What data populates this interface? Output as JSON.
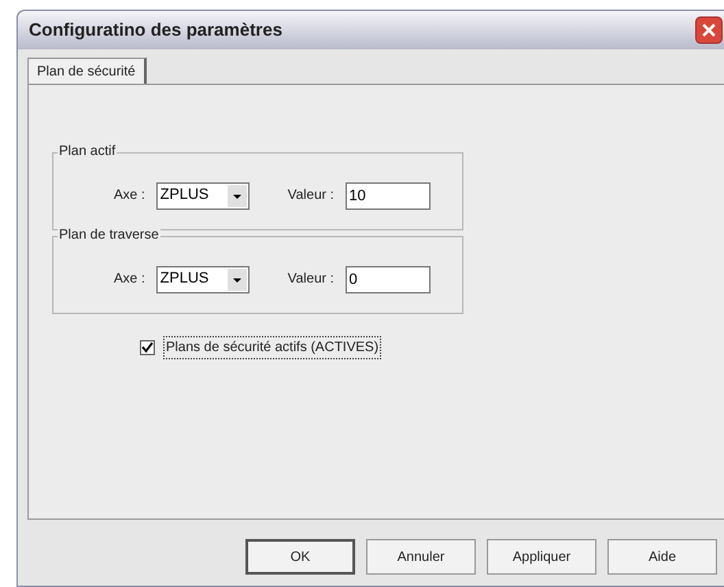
{
  "window": {
    "title": "Configuratino des paramètres"
  },
  "tabs": [
    {
      "label": "Plan de sécurité",
      "selected": true
    }
  ],
  "groups": [
    {
      "title": "Plan actif",
      "axis_label": "Axe :",
      "axis_value": "ZPLUS",
      "value_label": "Valeur :",
      "value": "10"
    },
    {
      "title": "Plan de traverse",
      "axis_label": "Axe :",
      "axis_value": "ZPLUS",
      "value_label": "Valeur :",
      "value": "0"
    }
  ],
  "checkbox": {
    "label": "Plans de sécurité actifs (ACTIVES)",
    "checked": true
  },
  "buttons": [
    {
      "label": "OK",
      "default": true
    },
    {
      "label": "Annuler",
      "default": false
    },
    {
      "label": "Appliquer",
      "default": false
    },
    {
      "label": "Aide",
      "default": false
    }
  ]
}
